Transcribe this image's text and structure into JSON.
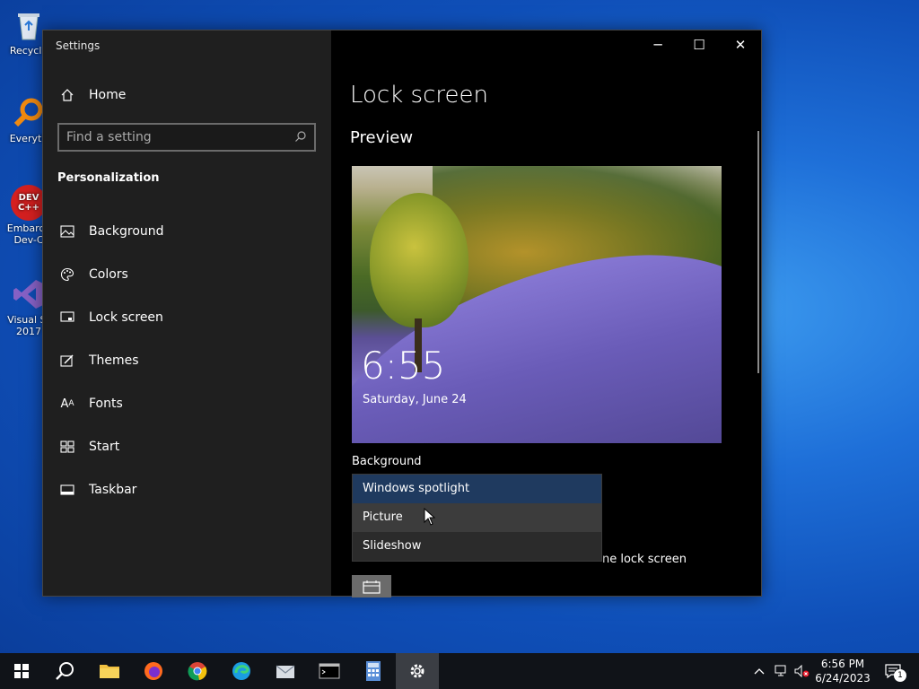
{
  "desktop": {
    "icons": [
      {
        "label": "Recycle",
        "icon": "recycle-bin-icon"
      },
      {
        "label": "Everyth",
        "icon": "everything-search-icon"
      },
      {
        "label": "Embarca",
        "label2": "Dev-C",
        "icon": "devcpp-icon",
        "badge": "DEV C++"
      },
      {
        "label": "Visual St",
        "label2": "2017",
        "icon": "visual-studio-icon"
      }
    ]
  },
  "window": {
    "title": "Settings",
    "controls": {
      "minimize": "─",
      "maximize": "☐",
      "close": "✕"
    }
  },
  "sidebar": {
    "home_label": "Home",
    "search_placeholder": "Find a setting",
    "section": "Personalization",
    "items": [
      {
        "label": "Background",
        "icon": "picture-icon"
      },
      {
        "label": "Colors",
        "icon": "palette-icon"
      },
      {
        "label": "Lock screen",
        "icon": "monitor-icon"
      },
      {
        "label": "Themes",
        "icon": "brush-icon"
      },
      {
        "label": "Fonts",
        "icon": "font-icon"
      },
      {
        "label": "Start",
        "icon": "start-grid-icon"
      },
      {
        "label": "Taskbar",
        "icon": "taskbar-icon"
      }
    ]
  },
  "content": {
    "title": "Lock screen",
    "preview_heading": "Preview",
    "preview_time": "6:55",
    "preview_date": "Saturday, June 24",
    "background_label": "Background",
    "dropdown_options": [
      "Windows spotlight",
      "Picture",
      "Slideshow"
    ],
    "dropdown_selected": "Windows spotlight",
    "dropdown_hovered": "Picture",
    "partial_text": "ne lock screen"
  },
  "taskbar": {
    "apps": [
      "start-icon",
      "search-icon",
      "file-explorer-icon",
      "firefox-icon",
      "chrome-icon",
      "edge-icon",
      "mail-icon",
      "terminal-icon",
      "calculator-icon",
      "settings-icon"
    ],
    "active_app": "settings-icon",
    "clock_time": "6:56 PM",
    "clock_date": "6/24/2023",
    "notification_count": "1"
  }
}
